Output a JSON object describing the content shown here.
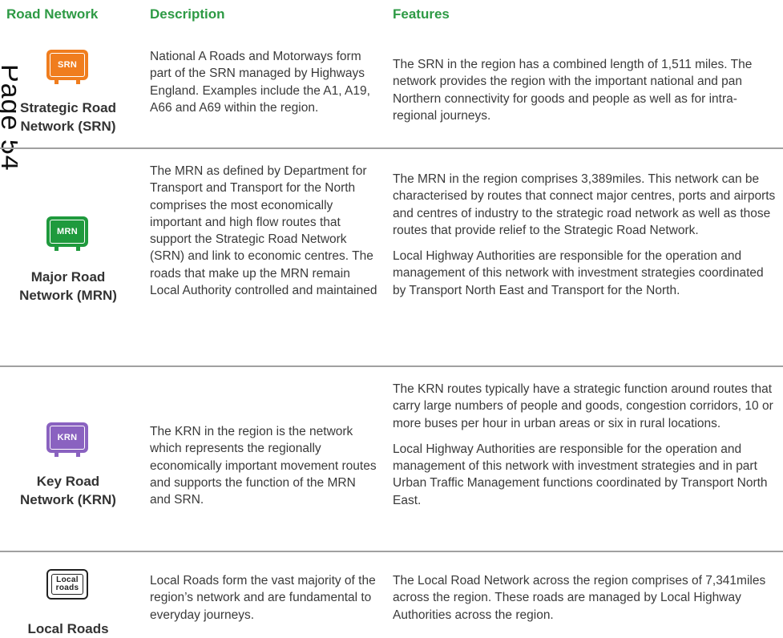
{
  "header": {
    "col_network": "Road Network",
    "col_description": "Description",
    "col_features": "Features"
  },
  "page_label": "Page 54",
  "colors": {
    "header_green": "#2d9a44",
    "srn_orange": "#f07d1e",
    "mrn_green": "#1f9a3d",
    "krn_purple": "#8a62c0",
    "divider": "#a0a0a0"
  },
  "rows": [
    {
      "badge": "SRN",
      "badge_icon": "srn-road-sign-icon",
      "name_line1": "Strategic Road",
      "name_line2": "Network (SRN)",
      "description": "National A Roads and Motorways form part of the SRN managed by Highways England. Examples include the A1, A19, A66 and A69 within the region.",
      "features": [
        "The SRN in the region has a combined length of 1,511 miles. The network provides the region with the important national and pan Northern connectivity for goods and people as well as for intra-regional journeys."
      ]
    },
    {
      "badge": "MRN",
      "badge_icon": "mrn-road-sign-icon",
      "name_line1": "Major Road",
      "name_line2": "Network (MRN)",
      "description": "The MRN as defined by Department for Transport and Transport for the North comprises the most economically important and high flow routes that support the Strategic Road Network (SRN) and link to economic centres. The roads that make up the MRN remain Local Authority controlled and maintained",
      "features": [
        "The MRN in the region comprises 3,389miles. This network can be characterised by routes that connect major centres, ports and airports and centres of industry to the strategic road network as well as those routes that provide relief to the Strategic Road Network.",
        "Local Highway Authorities are responsible for the operation and management of this network with investment strategies coordinated by Transport North East and Transport for the North."
      ]
    },
    {
      "badge": "KRN",
      "badge_icon": "krn-road-sign-icon",
      "name_line1": "Key Road",
      "name_line2": "Network (KRN)",
      "description": "The KRN in the region is the network which represents the regionally economically important movement routes and supports the function of the MRN and SRN.",
      "features": [
        "The KRN routes typically have a strategic function around routes that carry large numbers of people and goods, congestion corridors, 10 or more buses per hour in urban areas or six in rural locations.",
        "Local Highway Authorities are responsible for the operation and management of this network with investment strategies and in part Urban Traffic Management functions coordinated by Transport North East."
      ]
    },
    {
      "badge_line1": "Local",
      "badge_line2": "roads",
      "badge_icon": "local-roads-sign-icon",
      "name_line1": "Local Roads",
      "description": "Local Roads form the vast majority of the region’s network and are fundamental to everyday journeys.",
      "features": [
        "The Local Road Network across the region comprises of 7,341miles across the region. These roads are managed by Local Highway Authorities across the region."
      ]
    }
  ]
}
